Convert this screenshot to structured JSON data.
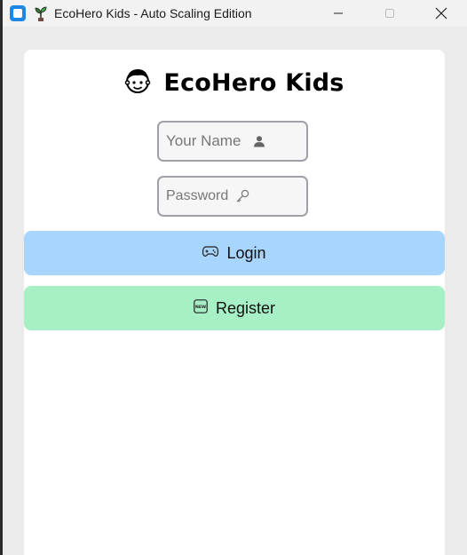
{
  "window": {
    "title": "EcoHero Kids - Auto Scaling Edition",
    "controls": [
      "minimize",
      "maximize",
      "close"
    ]
  },
  "app": {
    "heading": "EcoHero Kids",
    "heading_icon": "boy-face-icon"
  },
  "form": {
    "name_placeholder": "Your Name",
    "name_icon": "person-icon",
    "password_placeholder": "Password",
    "password_icon": "key-icon",
    "login_label": "Login",
    "login_icon": "game-controller-icon",
    "register_label": "Register",
    "register_icon": "new-badge-icon"
  },
  "colors": {
    "login_bg": "#a8d5fc",
    "register_bg": "#a7f0c6",
    "app_icon": "#1e88e5"
  }
}
